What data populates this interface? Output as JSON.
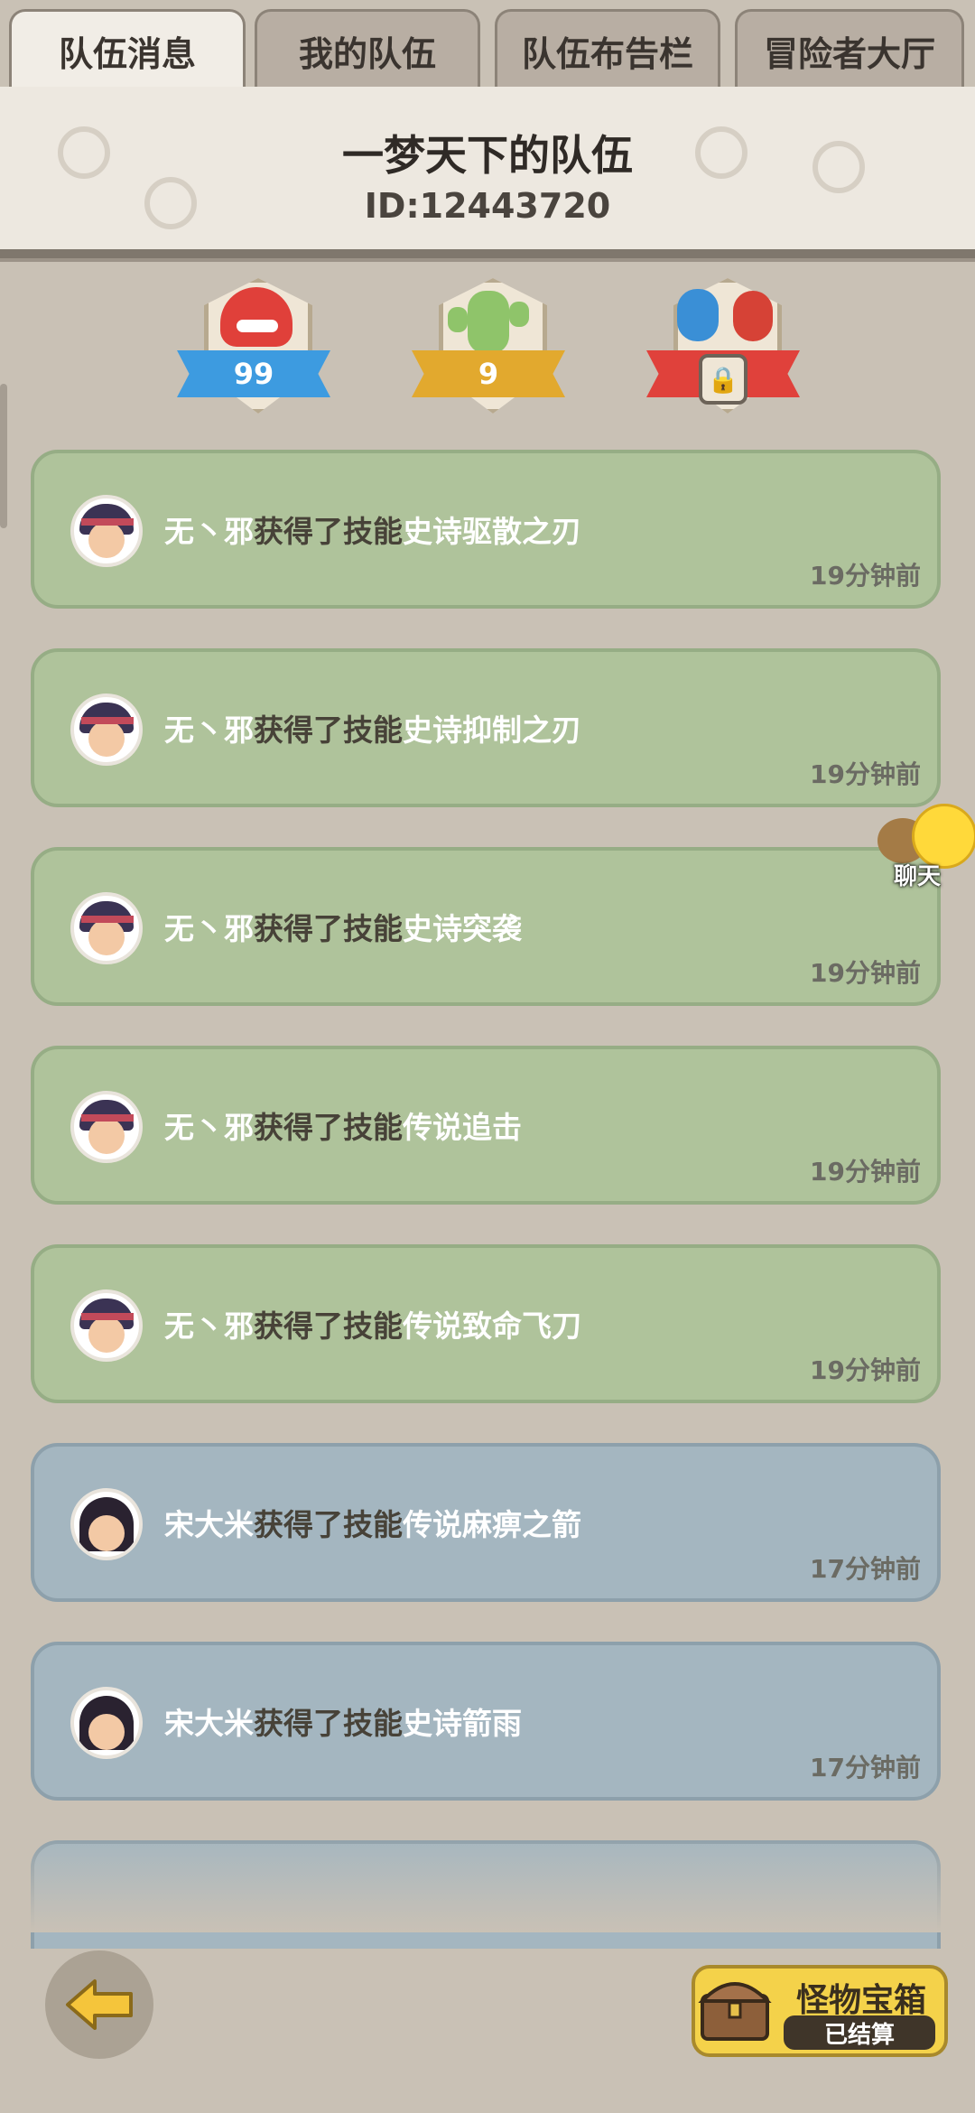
{
  "tabs": [
    {
      "label": "队伍消息",
      "active": true
    },
    {
      "label": "我的队伍",
      "active": false
    },
    {
      "label": "队伍布告栏",
      "active": false
    },
    {
      "label": "冒险者大厅",
      "active": false
    }
  ],
  "team": {
    "name": "一梦天下的队伍",
    "id": "ID:12443720"
  },
  "badges": [
    {
      "icon": "red-dinosaur-icon",
      "value": "99",
      "ribbon_color": "#3d9be0"
    },
    {
      "icon": "green-cactus-icon",
      "value": "9",
      "ribbon_color": "#e2a92e"
    },
    {
      "icon": "fighters-icon",
      "locked": true,
      "ribbon_color": "#e0413b"
    }
  ],
  "messages": [
    {
      "user": "无丶邪",
      "action": "获得了技能",
      "skill": "史诗驱散之刃",
      "time": "19分钟前",
      "theme": "green"
    },
    {
      "user": "无丶邪",
      "action": "获得了技能",
      "skill": "史诗抑制之刃",
      "time": "19分钟前",
      "theme": "green"
    },
    {
      "user": "无丶邪",
      "action": "获得了技能",
      "skill": "史诗突袭",
      "time": "19分钟前",
      "theme": "green"
    },
    {
      "user": "无丶邪",
      "action": "获得了技能",
      "skill": "传说追击",
      "time": "19分钟前",
      "theme": "green"
    },
    {
      "user": "无丶邪",
      "action": "获得了技能",
      "skill": "传说致命飞刀",
      "time": "19分钟前",
      "theme": "green"
    },
    {
      "user": "宋大米",
      "action": "获得了技能",
      "skill": "传说麻痹之箭",
      "time": "17分钟前",
      "theme": "blue"
    },
    {
      "user": "宋大米",
      "action": "获得了技能",
      "skill": "史诗箭雨",
      "time": "17分钟前",
      "theme": "blue"
    }
  ],
  "chat": {
    "label": "聊天"
  },
  "chest": {
    "title": "怪物宝箱",
    "status": "已结算"
  },
  "colors": {
    "green_card": "#afc39b",
    "blue_card": "#a4b6c0",
    "background": "#c9c1b5"
  }
}
